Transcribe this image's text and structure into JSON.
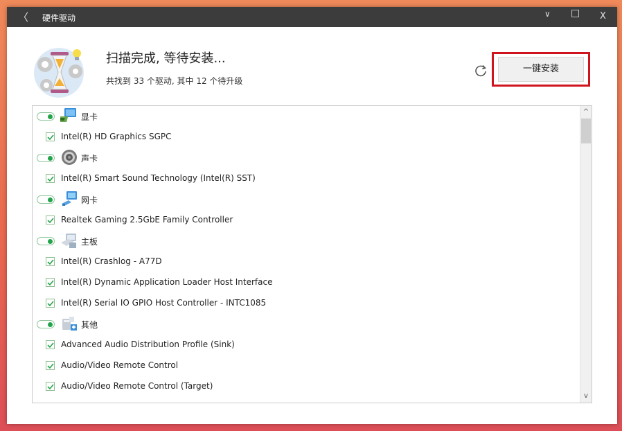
{
  "window": {
    "title": "硬件驱动",
    "back_glyph": "〈",
    "minimize_glyph": "∨",
    "maximize_glyph": "□",
    "close_glyph": "X"
  },
  "status": {
    "title": "扫描完成, 等待安装...",
    "subtitle": "共找到 33 个驱动, 其中 12 个待升级"
  },
  "actions": {
    "install_label": "一键安装"
  },
  "scrollbar": {
    "up": "^",
    "down": "v"
  },
  "driver_list": {
    "categories": [
      {
        "label": "显卡",
        "icon": "display-card-icon",
        "enabled": true,
        "items": [
          "Intel(R) HD Graphics SGPC"
        ]
      },
      {
        "label": "声卡",
        "icon": "speaker-icon",
        "enabled": true,
        "items": [
          "Intel(R) Smart Sound Technology (Intel(R) SST)"
        ]
      },
      {
        "label": "网卡",
        "icon": "network-card-icon",
        "enabled": true,
        "items": [
          "Realtek Gaming 2.5GbE Family Controller"
        ]
      },
      {
        "label": "主板",
        "icon": "motherboard-icon",
        "enabled": true,
        "items": [
          "Intel(R) Crashlog - A77D",
          "Intel(R) Dynamic Application Loader Host Interface",
          "Intel(R) Serial IO GPIO Host Controller - INTC1085"
        ]
      },
      {
        "label": "其他",
        "icon": "other-devices-icon",
        "enabled": true,
        "items": [
          "Advanced Audio Distribution Profile (Sink)",
          "Audio/Video Remote Control",
          "Audio/Video Remote Control (Target)"
        ]
      }
    ]
  },
  "colors": {
    "accent_red": "#d0141e",
    "toggle_green": "#23a34a",
    "titlebar": "#3c3c3c"
  }
}
